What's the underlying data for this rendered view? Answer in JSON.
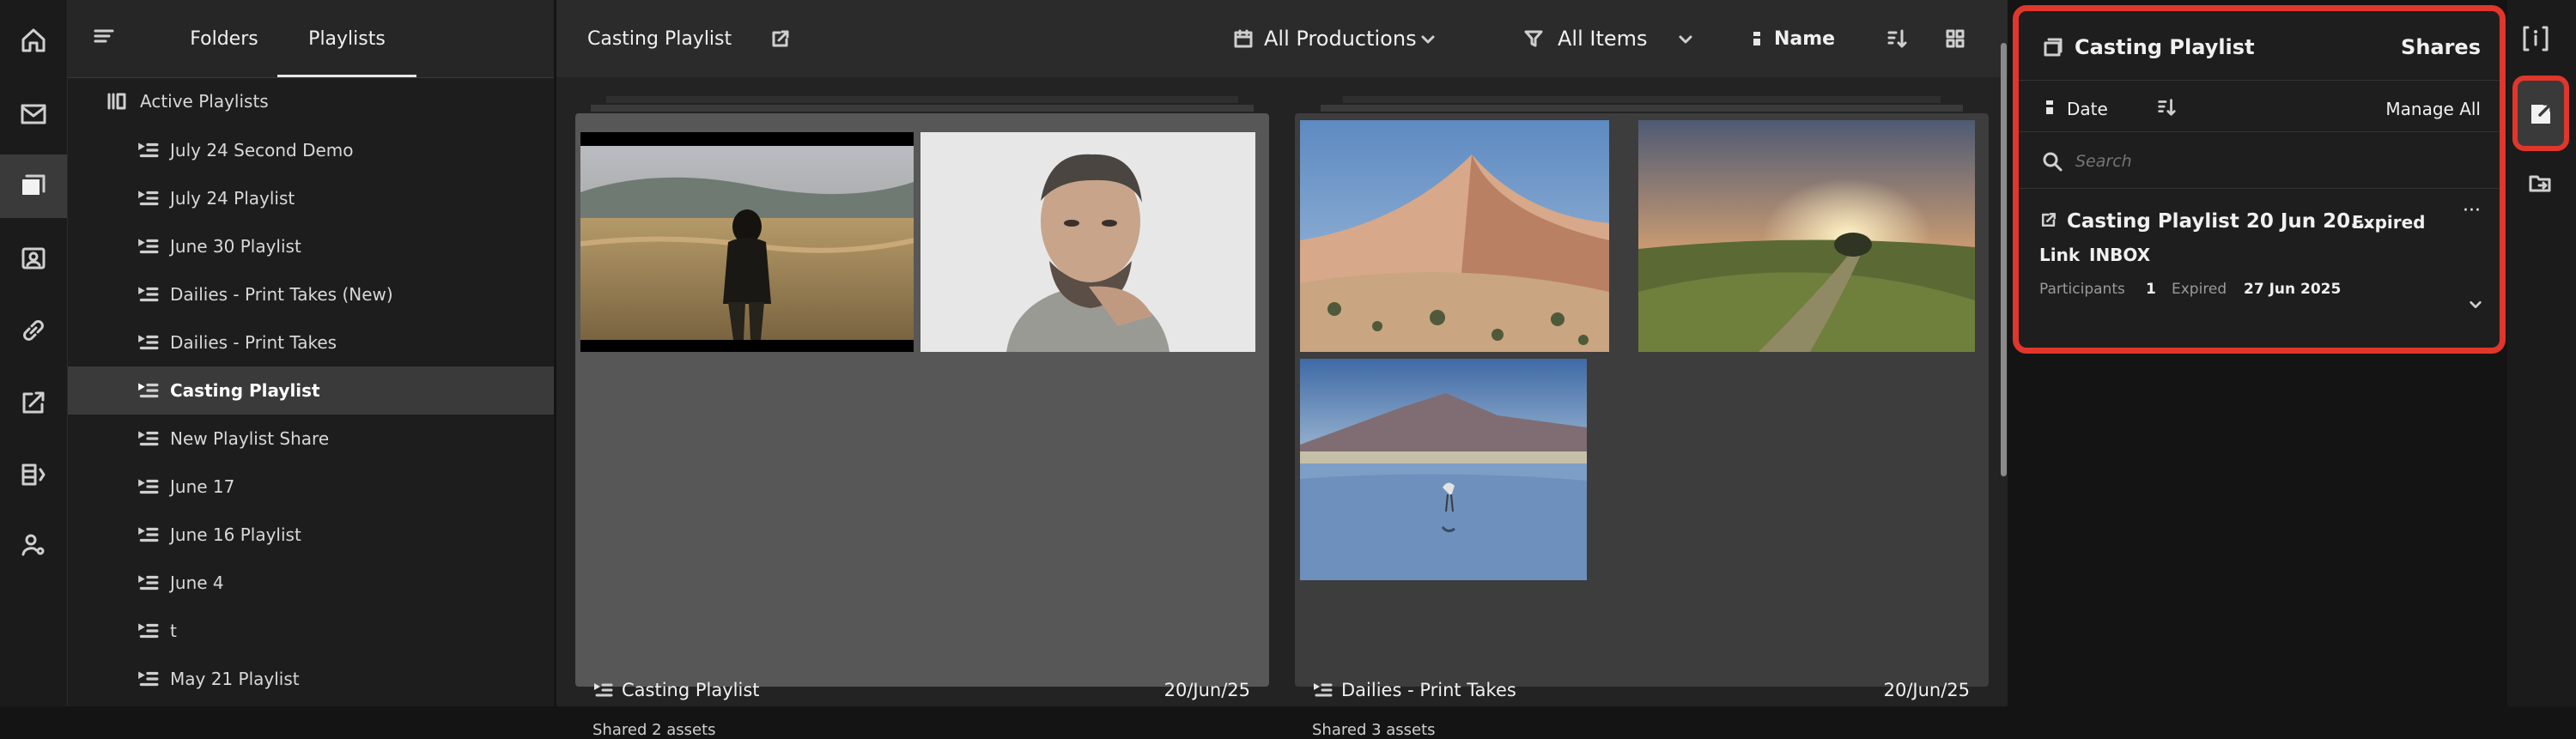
{
  "rail": {
    "items": [
      {
        "icon": "home-icon",
        "active": false
      },
      {
        "icon": "inbox-icon",
        "active": false
      },
      {
        "icon": "playlists-icon",
        "active": true
      },
      {
        "icon": "contacts-icon",
        "active": false
      },
      {
        "icon": "link-icon",
        "active": false
      },
      {
        "icon": "share-icon",
        "active": false
      },
      {
        "icon": "compare-icon",
        "active": false
      },
      {
        "icon": "user-settings-icon",
        "active": false
      }
    ]
  },
  "sidebar": {
    "tabs": [
      "Folders",
      "Playlists"
    ],
    "active_tab": "Playlists",
    "section_label": "Active Playlists",
    "items": [
      {
        "label": "July 24 Second Demo",
        "selected": false
      },
      {
        "label": "July 24 Playlist",
        "selected": false
      },
      {
        "label": "June 30 Playlist",
        "selected": false
      },
      {
        "label": "Dailies - Print Takes (New)",
        "selected": false
      },
      {
        "label": "Dailies - Print Takes",
        "selected": false
      },
      {
        "label": "Casting Playlist",
        "selected": true
      },
      {
        "label": "New Playlist Share",
        "selected": false
      },
      {
        "label": "June 17",
        "selected": false
      },
      {
        "label": "June 16 Playlist",
        "selected": false
      },
      {
        "label": "June 4",
        "selected": false
      },
      {
        "label": "t",
        "selected": false
      },
      {
        "label": "May 21 Playlist",
        "selected": false
      }
    ]
  },
  "main": {
    "title": "Casting Playlist",
    "filter_productions": "All Productions",
    "filter_items": "All Items",
    "sort_label": "Name",
    "cards": [
      {
        "title": "Casting Playlist",
        "date": "20/Jun/25",
        "subtitle": "Shared 2 assets",
        "selected": true
      },
      {
        "title": "Dailies - Print Takes",
        "date": "20/Jun/25",
        "subtitle": "Shared 3 assets",
        "selected": false
      }
    ]
  },
  "shares": {
    "title": "Casting Playlist",
    "tab_label": "Shares",
    "sort_label": "Date",
    "manage_all": "Manage All",
    "search_placeholder": "Search",
    "item": {
      "name": "Casting Playlist 20 Jun 20...",
      "status": "Expired",
      "type": "Link",
      "destination": "INBOX",
      "participants_label": "Participants",
      "participants_count": "1",
      "expired_label": "Expired",
      "expired_date": "27 Jun 2025",
      "more": "···"
    }
  },
  "colors": {
    "accent": "#e0362b",
    "background": "#141414",
    "selected_row": "#3a3a3a"
  }
}
